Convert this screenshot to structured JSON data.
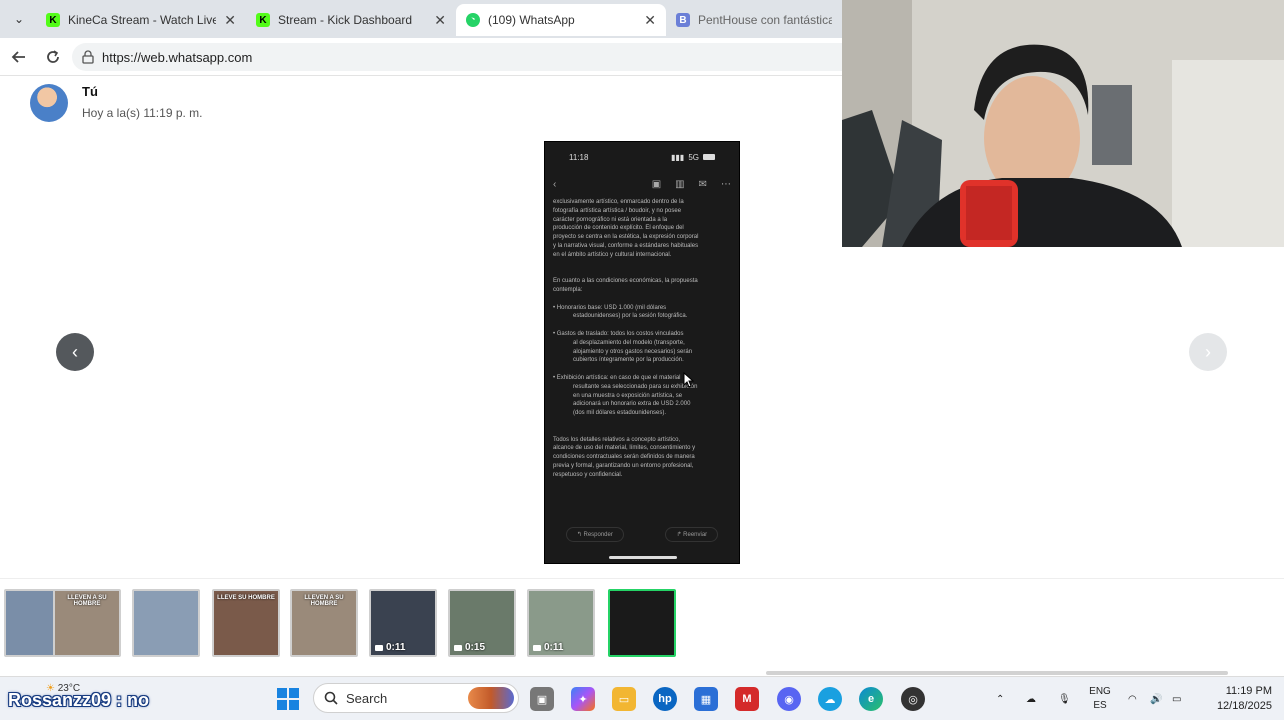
{
  "browser": {
    "tabs": [
      {
        "title": "KineCa Stream - Watch Live on",
        "icon_color": "#53fc18",
        "icon_letter": "K",
        "icon": "kick-icon"
      },
      {
        "title": "Stream - Kick Dashboard",
        "icon_color": "#53fc18",
        "icon_letter": "K",
        "icon": "kick-icon"
      },
      {
        "title": "(109) WhatsApp",
        "icon_color": "#25d366",
        "icon_letter": "",
        "icon": "whatsapp-icon"
      },
      {
        "title": "PentHouse con fantástica vist",
        "icon_color": "#6b7fd7",
        "icon_letter": "B",
        "icon": "booking-icon"
      }
    ],
    "url": "https://web.whatsapp.com"
  },
  "viewer": {
    "sender": "Tú",
    "timestamp": "Hoy a la(s) 11:19 p. m.",
    "phone": {
      "status_time": "11:18",
      "status_right": "5G",
      "lines": [
        "exclusivamente artístico, enmarcado dentro de la",
        "fotografía artística artística / boudoir, y no posee",
        "carácter pornográfico ni está orientada a la",
        "producción de contenido explícito. El enfoque del",
        "proyecto se centra en la estética, la expresión corporal",
        "y la narrativa visual, conforme a estándares habituales",
        "en el ámbito artístico y cultural internacional.",
        "",
        "",
        "En cuanto a las condiciones económicas, la propuesta",
        "contempla:",
        "",
        "• Honorarios base: USD 1.000 (mil dólares",
        "  estadounidenses) por la sesión fotográfica.",
        "",
        "• Gastos de traslado: todos los costos vinculados",
        "  al desplazamiento del modelo (transporte,",
        "  alojamiento y otros gastos necesarios) serán",
        "  cubiertos íntegramente por la producción.",
        "",
        "• Exhibición artística: en caso de que el material",
        "  resultante sea seleccionado para su exhibición",
        "  en una muestra o exposición artística, se",
        "  adicionará un honorario extra de USD 2.000",
        "  (dos mil dólares estadounidenses).",
        "",
        "",
        "Todos los detalles relativos a concepto artístico,",
        "alcance de uso del material, límites, consentimiento y",
        "condiciones contractuales serán definidos de manera",
        "previa y formal, garantizando un entorno profesional,",
        "respetuoso y confidencial."
      ],
      "reply_label": "Responder",
      "forward_label": "Reenviar"
    },
    "thumbnails": [
      {
        "caption": "",
        "duration": "",
        "video": false,
        "bg": "#7a8ea8"
      },
      {
        "caption": "LLEVEN A SU HOMBRE",
        "duration": "",
        "video": false,
        "bg": "#9a8a7a"
      },
      {
        "caption": "",
        "duration": "",
        "video": false,
        "bg": "#8a9db4"
      },
      {
        "caption": "LLEVE SU HOMBRE",
        "duration": "",
        "video": false,
        "bg": "#7a5a4a"
      },
      {
        "caption": "LLEVEN A SU HOMBRE",
        "duration": "",
        "video": false,
        "bg": "#9a8a7a"
      },
      {
        "caption": "",
        "duration": "0:11",
        "video": true,
        "bg": "#3a4250"
      },
      {
        "caption": "",
        "duration": "0:15",
        "video": true,
        "bg": "#6a7a6a"
      },
      {
        "caption": "",
        "duration": "0:11",
        "video": true,
        "bg": "#8a9a8a"
      },
      {
        "caption": "",
        "duration": "",
        "video": false,
        "bg": "#1a1a1a"
      }
    ]
  },
  "overlay": {
    "chat_message": "Rossanzz09 : no"
  },
  "taskbar": {
    "weather": "23°C",
    "search_placeholder": "Search",
    "language": "ENG",
    "language_sub": "ES",
    "time": "11:19 PM",
    "date": "12/18/2025"
  }
}
